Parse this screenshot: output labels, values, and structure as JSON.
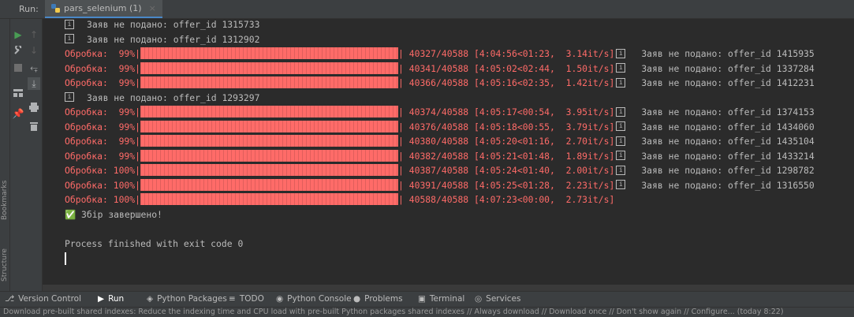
{
  "header": {
    "run_label": "Run:",
    "tab_label": "pars_selenium (1)",
    "tab_close": "×"
  },
  "side_labels": {
    "bookmarks": "Bookmarks",
    "structure": "Structure"
  },
  "console": {
    "lines": [
      {
        "kind": "info",
        "text": "Заяв не подано: offer_id 1315733"
      },
      {
        "kind": "info",
        "text": "Заяв не подано: offer_id 1312902"
      },
      {
        "kind": "progress",
        "label": "Обробка:  99%|",
        "stats": "| 40327/40588 [4:04:56<01:23,  3.14it/s]",
        "tail": "Заяв не подано: offer_id 1415935"
      },
      {
        "kind": "progress",
        "label": "Обробка:  99%|",
        "stats": "| 40341/40588 [4:05:02<02:44,  1.50it/s]",
        "tail": "Заяв не подано: offer_id 1337284"
      },
      {
        "kind": "progress",
        "label": "Обробка:  99%|",
        "stats": "| 40366/40588 [4:05:16<02:35,  1.42it/s]",
        "tail": "Заяв не подано: offer_id 1412231"
      },
      {
        "kind": "info",
        "text": "Заяв не подано: offer_id 1293297"
      },
      {
        "kind": "progress",
        "label": "Обробка:  99%|",
        "stats": "| 40374/40588 [4:05:17<00:54,  3.95it/s]",
        "tail": "Заяв не подано: offer_id 1374153"
      },
      {
        "kind": "progress",
        "label": "Обробка:  99%|",
        "stats": "| 40376/40588 [4:05:18<00:55,  3.79it/s]",
        "tail": "Заяв не подано: offer_id 1434060"
      },
      {
        "kind": "progress",
        "label": "Обробка:  99%|",
        "stats": "| 40380/40588 [4:05:20<01:16,  2.70it/s]",
        "tail": "Заяв не подано: offer_id 1435104"
      },
      {
        "kind": "progress",
        "label": "Обробка:  99%|",
        "stats": "| 40382/40588 [4:05:21<01:48,  1.89it/s]",
        "tail": "Заяв не подано: offer_id 1433214"
      },
      {
        "kind": "progress",
        "label": "Обробка: 100%|",
        "stats": "| 40387/40588 [4:05:24<01:40,  2.00it/s]",
        "tail": "Заяв не подано: offer_id 1298782"
      },
      {
        "kind": "progress",
        "label": "Обробка: 100%|",
        "stats": "| 40391/40588 [4:05:25<01:28,  2.23it/s]",
        "tail": "Заяв не подано: offer_id 1316550"
      },
      {
        "kind": "progress",
        "label": "Обробка: 100%|",
        "stats": "| 40588/40588 [4:07:23<00:00,  2.73it/s]",
        "tail": ""
      },
      {
        "kind": "done",
        "text": "✅ Збір завершено!"
      },
      {
        "kind": "blank",
        "text": ""
      },
      {
        "kind": "exit",
        "text": "Process finished with exit code 0"
      }
    ]
  },
  "bottom_tabs": [
    {
      "icon": "⎇",
      "label": "Version Control"
    },
    {
      "icon": "▶",
      "label": "Run"
    },
    {
      "icon": "◈",
      "label": "Python Packages"
    },
    {
      "icon": "≡",
      "label": "TODO"
    },
    {
      "icon": "◉",
      "label": "Python Console"
    },
    {
      "icon": "●",
      "label": "Problems"
    },
    {
      "icon": "▣",
      "label": "Terminal"
    },
    {
      "icon": "◎",
      "label": "Services"
    }
  ],
  "status": {
    "message": "Download pre-built shared indexes: Reduce the indexing time and CPU load with pre-built Python packages shared indexes // Always download // Download once // Don't show again // Configure... (today 8:22)"
  },
  "colors": {
    "error_red": "#ff6b68",
    "run_green": "#499c54",
    "accent_blue": "#4a88c7"
  }
}
